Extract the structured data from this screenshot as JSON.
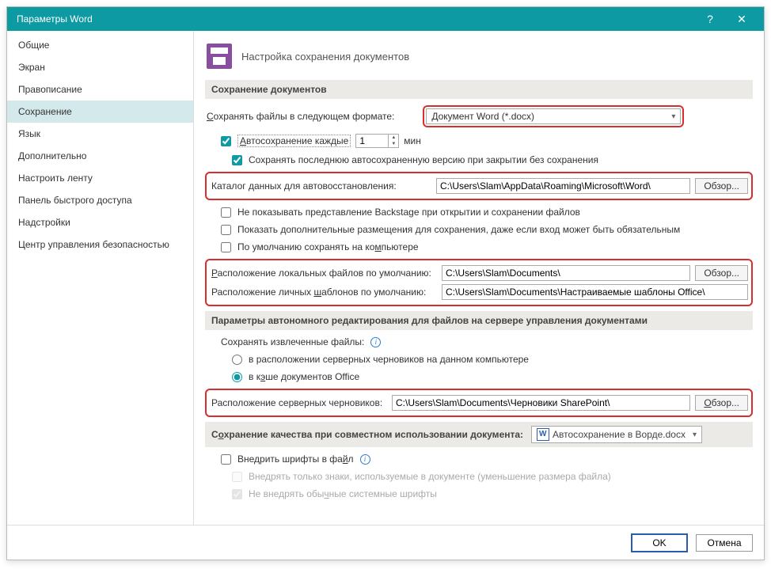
{
  "title": "Параметры Word",
  "sidebar": {
    "items": [
      {
        "label": "Общие"
      },
      {
        "label": "Экран"
      },
      {
        "label": "Правописание"
      },
      {
        "label": "Сохранение"
      },
      {
        "label": "Язык"
      },
      {
        "label": "Дополнительно"
      },
      {
        "label": "Настроить ленту"
      },
      {
        "label": "Панель быстрого доступа"
      },
      {
        "label": "Надстройки"
      },
      {
        "label": "Центр управления безопасностью"
      }
    ],
    "selected_index": 3
  },
  "header": {
    "text": "Настройка сохранения документов"
  },
  "section1": {
    "title": "Сохранение документов",
    "format_label": "Сохранять файлы в следующем формате:",
    "format_value": "Документ Word (*.docx)",
    "autosave_label": "Автосохранение каждые",
    "autosave_value": "1",
    "autosave_unit": "мин",
    "keep_last_label": "Сохранять последнюю автосохраненную версию при закрытии без сохранения",
    "recovery_dir_label": "Каталог данных для автовосстановления:",
    "recovery_dir_value": "C:\\Users\\Slam\\AppData\\Roaming\\Microsoft\\Word\\",
    "no_backstage_label": "Не показывать представление Backstage при открытии и сохранении файлов",
    "extra_places_label": "Показать дополнительные размещения для сохранения, даже если вход может быть обязательным",
    "save_local_label": "По умолчанию сохранять на компьютере",
    "local_files_label": "Расположение локальных файлов по умолчанию:",
    "local_files_value": "C:\\Users\\Slam\\Documents\\",
    "personal_templates_label": "Расположение личных шаблонов по умолчанию:",
    "personal_templates_value": "C:\\Users\\Slam\\Documents\\Настраиваемые шаблоны Office\\",
    "browse": "Обзор..."
  },
  "section2": {
    "title": "Параметры автономного редактирования для файлов на сервере управления документами",
    "save_extracted_label": "Сохранять извлеченные файлы:",
    "opt_server_drafts": "в расположении серверных черновиков на данном компьютере",
    "opt_office_cache": "в кэше документов Office",
    "server_drafts_label": "Расположение серверных черновиков:",
    "server_drafts_value": "C:\\Users\\Slam\\Documents\\Черновики SharePoint\\",
    "browse": "Обзор..."
  },
  "section3": {
    "title": "Сохранение качества при совместном использовании документа:",
    "doc_name": "Автосохранение в Ворде.docx",
    "embed_fonts_label": "Внедрить шрифты в файл",
    "embed_chars_label": "Внедрять только знаки, используемые в документе (уменьшение размера файла)",
    "no_sys_fonts_label": "Не внедрять обычные системные шрифты"
  },
  "footer": {
    "ok": "OK",
    "cancel": "Отмена"
  }
}
